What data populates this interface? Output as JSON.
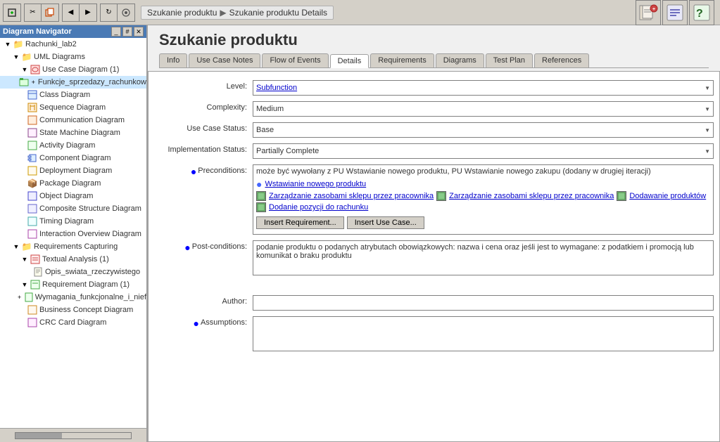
{
  "window": {
    "title": "Diagram Navigator"
  },
  "breadcrumbs": [
    "Szukanie produktu",
    "Szukanie produktu Details"
  ],
  "page_title": "Szukanie produktu",
  "tabs": [
    {
      "label": "Info",
      "active": false
    },
    {
      "label": "Use Case Notes",
      "active": false
    },
    {
      "label": "Flow of Events",
      "active": false
    },
    {
      "label": "Details",
      "active": true
    },
    {
      "label": "Requirements",
      "active": false
    },
    {
      "label": "Diagrams",
      "active": false
    },
    {
      "label": "Test Plan",
      "active": false
    },
    {
      "label": "References",
      "active": false
    }
  ],
  "form": {
    "level_label": "Level:",
    "level_value": "Subfunction",
    "complexity_label": "Complexity:",
    "complexity_value": "Medium",
    "use_case_status_label": "Use Case Status:",
    "use_case_status_value": "Base",
    "impl_status_label": "Implementation Status:",
    "impl_status_value": "Partially Complete",
    "preconditions_label": "Preconditions:",
    "preconditions_text": "może być wywołany z PU Wstawianie nowego produktu, PU Wstawianie nowego zakupu (dodany w drugiej iteracji)",
    "precond_link1": "Wstawianie nowego produktu",
    "precond_link2": "Zarządzanie zasobami sklepu przez pracownika",
    "precond_link3": "Zarządzanie zasobami sklepu przez pracownika",
    "precond_link4": "Dodawanie produktów",
    "precond_link5": "Dodanie pozycji do rachunku",
    "btn_insert_req": "Insert Requirement...",
    "btn_insert_use_case": "Insert Use Case...",
    "postconditions_label": "Post-conditions:",
    "postconditions_text": "podanie produktu o podanych atrybutach obowiązkowych: nazwa i cena oraz jeśli jest to wymagane: z podatkiem i promocją lub komunikat o braku produktu",
    "author_label": "Author:",
    "author_value": "",
    "assumptions_label": "Assumptions:"
  },
  "sidebar": {
    "title": "Diagram Navigator",
    "root": "Rachunki_lab2",
    "items": [
      {
        "label": "UML Diagrams",
        "type": "folder",
        "level": 1
      },
      {
        "label": "Use Case Diagram (1)",
        "type": "use-case",
        "level": 2
      },
      {
        "label": "Funkcje_sprzedazy_rachunkow",
        "type": "diagram",
        "level": 3
      },
      {
        "label": "Class Diagram",
        "type": "class",
        "level": 2
      },
      {
        "label": "Sequence Diagram",
        "type": "sequence",
        "level": 2
      },
      {
        "label": "Communication Diagram",
        "type": "communication",
        "level": 2
      },
      {
        "label": "State Machine Diagram",
        "type": "state",
        "level": 2
      },
      {
        "label": "Activity Diagram",
        "type": "activity",
        "level": 2
      },
      {
        "label": "Component Diagram",
        "type": "component",
        "level": 2
      },
      {
        "label": "Deployment Diagram",
        "type": "deployment",
        "level": 2
      },
      {
        "label": "Package Diagram",
        "type": "package",
        "level": 2
      },
      {
        "label": "Object Diagram",
        "type": "object",
        "level": 2
      },
      {
        "label": "Composite Structure Diagram",
        "type": "composite",
        "level": 2
      },
      {
        "label": "Timing Diagram",
        "type": "timing",
        "level": 2
      },
      {
        "label": "Interaction Overview Diagram",
        "type": "interaction",
        "level": 2
      },
      {
        "label": "Requirements Capturing",
        "type": "folder",
        "level": 1
      },
      {
        "label": "Textual Analysis (1)",
        "type": "textual",
        "level": 2
      },
      {
        "label": "Opis_swiata_rzeczywistego",
        "type": "doc",
        "level": 3
      },
      {
        "label": "Requirement Diagram (1)",
        "type": "req",
        "level": 2
      },
      {
        "label": "Wymagania_funkcjonalne_i_nief",
        "type": "doc",
        "level": 3
      },
      {
        "label": "Business Concept Diagram",
        "type": "business",
        "level": 2
      },
      {
        "label": "CRC Card Diagram",
        "type": "crc",
        "level": 2
      }
    ]
  },
  "icons": {
    "gear": "⚙",
    "arrow_right": "▶",
    "arrow_down": "▼",
    "folder": "📁",
    "document": "📄",
    "expand": "+",
    "collapse": "-"
  }
}
